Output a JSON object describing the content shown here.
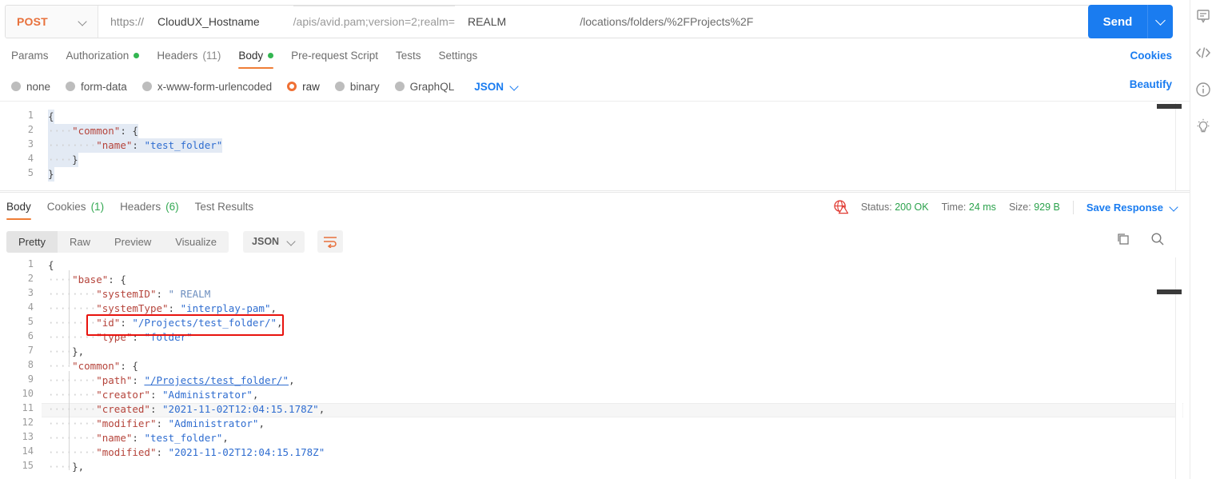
{
  "request": {
    "method": "POST",
    "url": {
      "protocol": "https://",
      "host": "CloudUX_Hostname",
      "path_prefix": "/apis/avid.pam;version=2;realm=",
      "realm": "REALM",
      "path_suffix": "/locations/folders/%2FProjects%2F"
    },
    "send_label": "Send",
    "tabs": [
      {
        "label": "Params",
        "badge": "",
        "dot": false,
        "active": false
      },
      {
        "label": "Authorization",
        "badge": "",
        "dot": true,
        "active": false
      },
      {
        "label": "Headers",
        "badge": "(11)",
        "dot": false,
        "active": false
      },
      {
        "label": "Body",
        "badge": "",
        "dot": true,
        "active": true
      },
      {
        "label": "Pre-request Script",
        "badge": "",
        "dot": false,
        "active": false
      },
      {
        "label": "Tests",
        "badge": "",
        "dot": false,
        "active": false
      },
      {
        "label": "Settings",
        "badge": "",
        "dot": false,
        "active": false
      }
    ],
    "cookies_link": "Cookies",
    "beautify_link": "Beautify",
    "body_types": [
      {
        "label": "none",
        "selected": false
      },
      {
        "label": "form-data",
        "selected": false
      },
      {
        "label": "x-www-form-urlencoded",
        "selected": false
      },
      {
        "label": "raw",
        "selected": true
      },
      {
        "label": "binary",
        "selected": false
      },
      {
        "label": "GraphQL",
        "selected": false
      }
    ],
    "body_format": "JSON",
    "body_lines": [
      {
        "n": "1",
        "text": "{"
      },
      {
        "n": "2",
        "text": "    \"common\": {"
      },
      {
        "n": "3",
        "text": "        \"name\": \"test_folder\""
      },
      {
        "n": "4",
        "text": "    }"
      },
      {
        "n": "5",
        "text": "}"
      }
    ]
  },
  "response": {
    "tabs": [
      {
        "label": "Body",
        "badge": "",
        "active": true
      },
      {
        "label": "Cookies",
        "badge": "(1)",
        "active": false
      },
      {
        "label": "Headers",
        "badge": "(6)",
        "active": false
      },
      {
        "label": "Test Results",
        "badge": "",
        "active": false
      }
    ],
    "status_label": "Status:",
    "status_value": "200 OK",
    "time_label": "Time:",
    "time_value": "24 ms",
    "size_label": "Size:",
    "size_value": "929 B",
    "save_response": "Save Response",
    "view_modes": [
      {
        "label": "Pretty",
        "active": true
      },
      {
        "label": "Raw",
        "active": false
      },
      {
        "label": "Preview",
        "active": false
      },
      {
        "label": "Visualize",
        "active": false
      }
    ],
    "format": "JSON",
    "body_lines": [
      {
        "n": "1",
        "text": "{"
      },
      {
        "n": "2",
        "text": "    \"base\": {"
      },
      {
        "n": "3",
        "text": "        \"systemID\": \" REALM"
      },
      {
        "n": "4",
        "text": "        \"systemType\": \"interplay-pam\","
      },
      {
        "n": "5",
        "text": "        \"id\": \"/Projects/test_folder/\","
      },
      {
        "n": "6",
        "text": "        \"type\": \"folder\""
      },
      {
        "n": "7",
        "text": "    },"
      },
      {
        "n": "8",
        "text": "    \"common\": {"
      },
      {
        "n": "9",
        "text": "        \"path\": \"/Projects/test_folder/\","
      },
      {
        "n": "10",
        "text": "        \"creator\": \"Administrator\","
      },
      {
        "n": "11",
        "text": "        \"created\": \"2021-11-02T12:04:15.178Z\","
      },
      {
        "n": "12",
        "text": "        \"modifier\": \"Administrator\","
      },
      {
        "n": "13",
        "text": "        \"name\": \"test_folder\","
      },
      {
        "n": "14",
        "text": "        \"modified\": \"2021-11-02T12:04:15.178Z\""
      },
      {
        "n": "15",
        "text": "    },"
      }
    ],
    "annotation": {
      "target_line": "5",
      "color": "#e8130e"
    }
  },
  "rail_icons": [
    "comment-icon",
    "code-icon",
    "info-icon",
    "lightbulb-icon"
  ],
  "colors": {
    "accent_orange": "#ef7034",
    "link_blue": "#1a7cf0",
    "status_green": "#2ba24c",
    "annotation_red": "#e8130e"
  }
}
